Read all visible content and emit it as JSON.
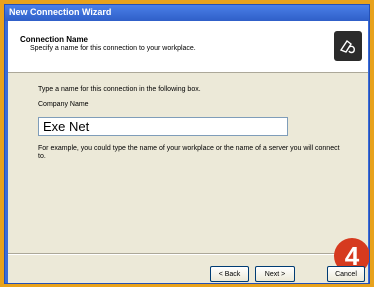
{
  "window": {
    "title": "New Connection Wizard"
  },
  "header": {
    "title": "Connection Name",
    "subtitle": "Specify a name for this connection to your workplace.",
    "icon": "wizard-connection-icon"
  },
  "form": {
    "instruction": "Type a name for this connection in the following box.",
    "company_label": "Company Name",
    "company_value": "Exe Net",
    "hint": "For example, you could type the name of your workplace or the name of a server you will connect to."
  },
  "buttons": {
    "back": "< Back",
    "next": "Next >",
    "cancel": "Cancel"
  },
  "step_badge": "4",
  "colors": {
    "frame": "#e8a21c",
    "titlebar": "#2f5fc8",
    "dialog_bg": "#ece9d8",
    "badge": "#d63a1f"
  }
}
